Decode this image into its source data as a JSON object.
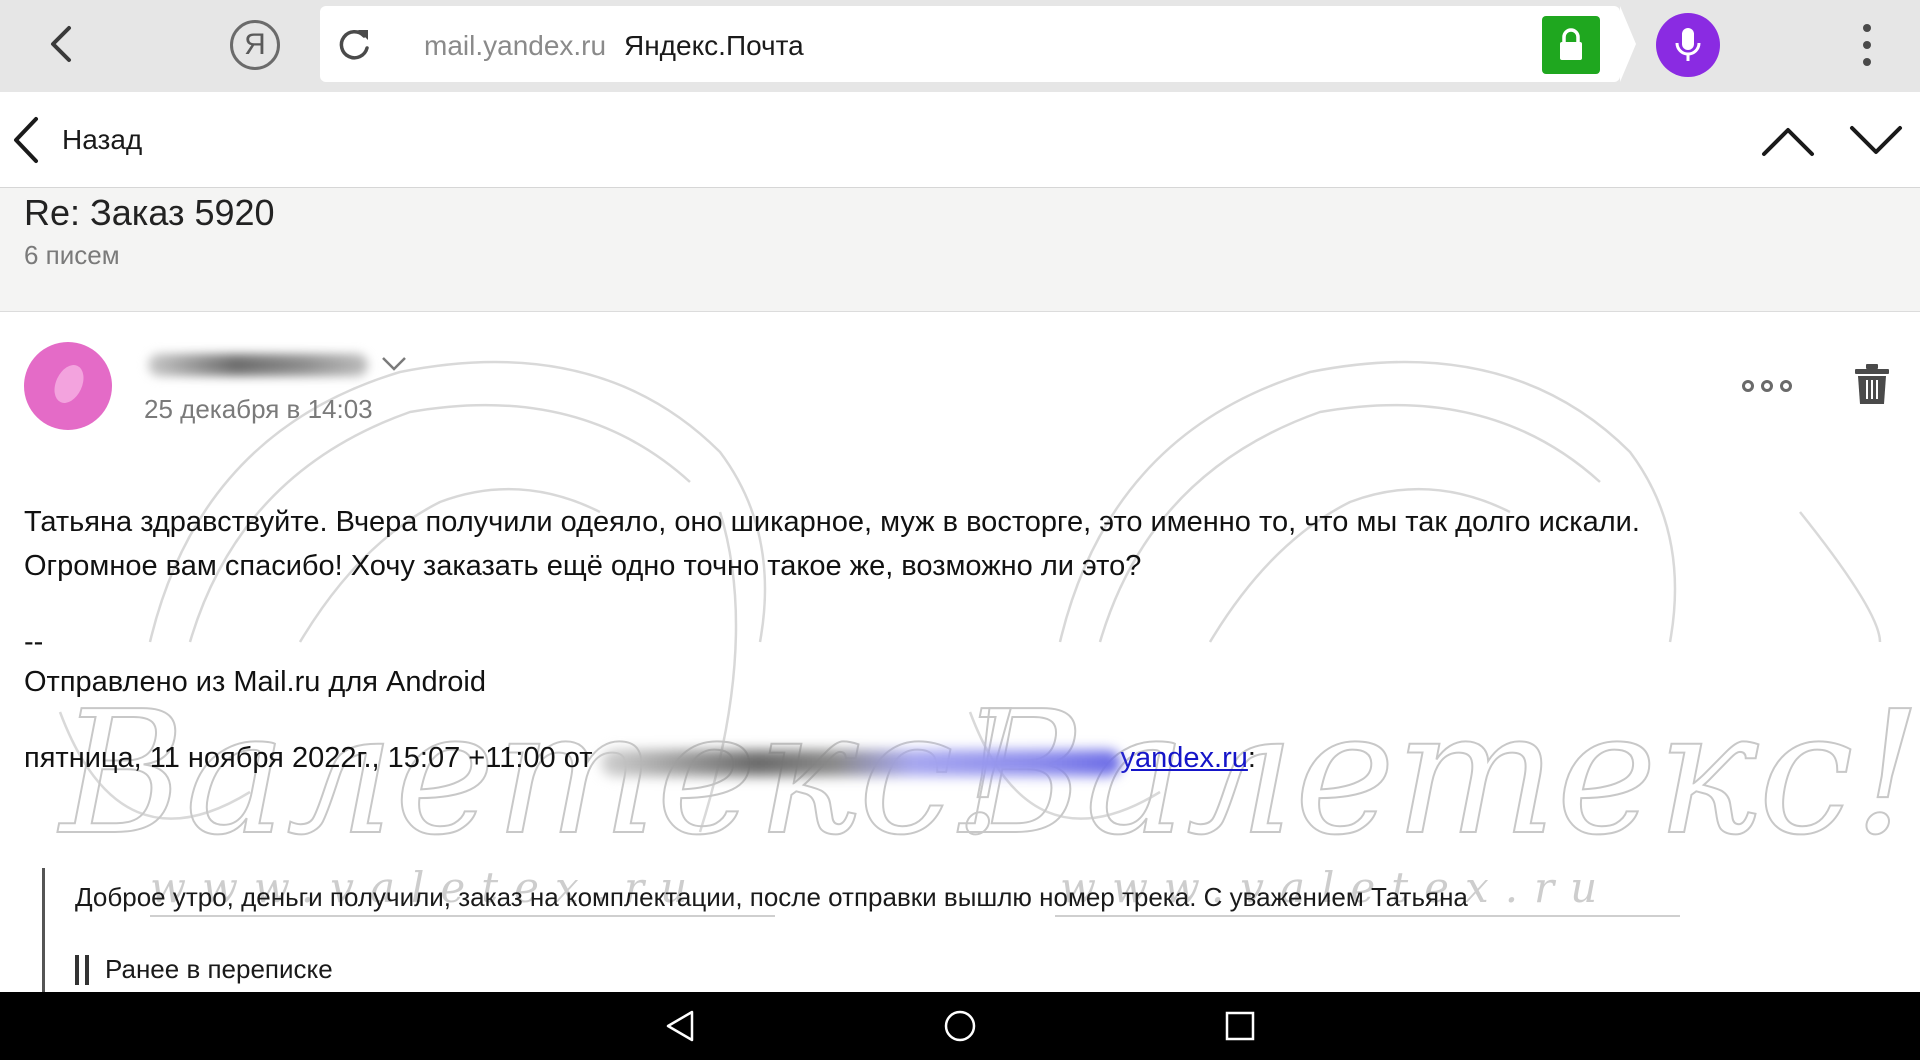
{
  "browser": {
    "domain": "mail.yandex.ru",
    "page_title": "Яндекс.Почта",
    "ya_letter": "Я",
    "lock_color": "#1fa71f",
    "mic_color": "#8a2be2",
    "icons": [
      "back-arrow-icon",
      "yandex-icon",
      "reload-icon",
      "lock-icon",
      "microphone-icon",
      "more-vertical-icon"
    ]
  },
  "nav": {
    "back_label": "Назад",
    "icons": [
      "back-chevron-icon",
      "chevron-up-icon",
      "chevron-down-icon"
    ]
  },
  "thread": {
    "subject": "Re: Заказ 5920",
    "count": "6 писем"
  },
  "message": {
    "date": "25 декабря в 14:03",
    "avatar_color": "#e46bc7",
    "body_lines": [
      "Татьяна здравствуйте. Вчера получили одеяло, оно шикарное, муж в восторге, это именно то, что мы так долго искали.",
      "Огромное вам спасибо! Хочу заказать ещё одно точно такое же, возможно ли это?"
    ],
    "signature_separator": "--",
    "signature": "Отправлено из Mail.ru для Android",
    "reply_header_prefix": "пятница, 11 ноября 2022г., 15:07 +11:00 от",
    "reply_email_domain": "yandex.ru",
    "reply_header_suffix": ":",
    "quote_text": "Доброе утро, деньги получили, заказ на комплектации, после отправки вышлю номер трека. С уважением Татьяна",
    "quote_earlier": "Ранее в переписке",
    "watermark_text": "Валетекс!",
    "watermark_url": "www.valetex.ru",
    "icons": [
      "sender-chevron-icon",
      "more-horizontal-icon",
      "trash-icon"
    ]
  },
  "android": {
    "icons": [
      "android-back-icon",
      "android-home-icon",
      "android-recent-icon"
    ]
  }
}
